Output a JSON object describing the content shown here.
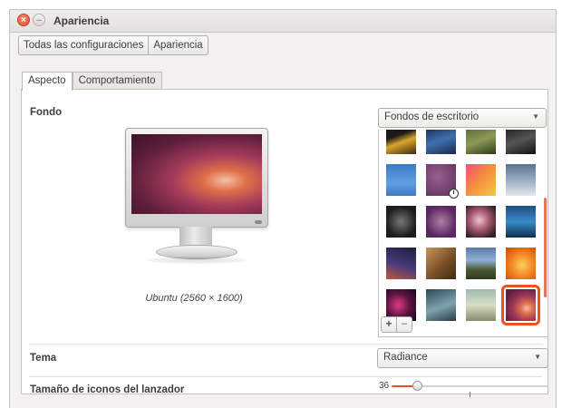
{
  "window": {
    "title": "Apariencia",
    "close_glyph": "×",
    "minimize_glyph": "–"
  },
  "breadcrumb": [
    "Todas las configuraciones",
    "Apariencia"
  ],
  "tabs": [
    {
      "label": "Aspecto",
      "active": true
    },
    {
      "label": "Comportamiento",
      "active": false
    }
  ],
  "background": {
    "label": "Fondo",
    "source_value": "Fondos de escritorio",
    "caption": "Ubuntu (2560 × 1600)",
    "add_label": "+",
    "remove_label": "−",
    "thumbnails": [
      {
        "name": "wallpaper-1",
        "bg": "linear-gradient(160deg,#1a1a1a 40%,#d9a52e 60%,#3b2a10)"
      },
      {
        "name": "wallpaper-2",
        "bg": "linear-gradient(160deg,#0d1d3c,#3f6fb0 55%,#1a2a4a)"
      },
      {
        "name": "wallpaper-3",
        "bg": "linear-gradient(160deg,#4c5a30,#8c9a58 55%,#2f3a1c)"
      },
      {
        "name": "wallpaper-4",
        "bg": "linear-gradient(160deg,#111,#555 55%,#111)"
      },
      {
        "name": "wallpaper-5",
        "bg": "linear-gradient(180deg,#3d7ac5,#5fa0e0 60%,#3d7ac5)"
      },
      {
        "name": "wallpaper-6",
        "bg": "radial-gradient(circle at 40% 40%,#9a5f8e,#5a2f5a)",
        "clock": true
      },
      {
        "name": "wallpaper-7",
        "bg": "linear-gradient(135deg,#f24e78,#f5913c 50%,#f7c84a)"
      },
      {
        "name": "wallpaper-8",
        "bg": "linear-gradient(180deg,#5d7290,#9fb2c6 55%,#e2e8ee)"
      },
      {
        "name": "wallpaper-9",
        "bg": "radial-gradient(circle at 50% 50%,#777,#1c1c1c 70%)"
      },
      {
        "name": "wallpaper-10",
        "bg": "radial-gradient(circle at 50% 50%,#b07fa8,#5a2760 70%)"
      },
      {
        "name": "wallpaper-11",
        "bg": "radial-gradient(circle at 45% 45%,#f0c5c9,#a85a72 40%,#3a1f28 80%)"
      },
      {
        "name": "wallpaper-12",
        "bg": "linear-gradient(180deg,#1f4d80,#3a8cc8 50%,#0e2e52)"
      },
      {
        "name": "wallpaper-13",
        "bg": "linear-gradient(200deg,#1a1f3c,#4a3a7a 55%,#c0583a)"
      },
      {
        "name": "wallpaper-14",
        "bg": "linear-gradient(135deg,#c8955c,#7a5028 55%,#3e2810)"
      },
      {
        "name": "wallpaper-15",
        "bg": "linear-gradient(180deg,#5c7aa8,#8fb0d8 40%,#4a5a32 70%,#2f3a1c)"
      },
      {
        "name": "wallpaper-16",
        "bg": "radial-gradient(circle at 55% 55%,#fbd15a,#f0831e 50%,#c44a10)"
      },
      {
        "name": "wallpaper-17",
        "bg": "radial-gradient(circle at 40% 50%,#e23a82,#5a1440 50%,#140816)"
      },
      {
        "name": "wallpaper-18",
        "bg": "linear-gradient(160deg,#2c4a56,#7fa3ae 55%,#253c44)"
      },
      {
        "name": "wallpaper-19",
        "bg": "linear-gradient(180deg,#9fb8b0,#d8dfc6 50%,#8a8a6a)"
      },
      {
        "name": "wallpaper-20",
        "bg": "radial-gradient(ellipse at 70% 60%,#f3c0a6,#e0704a 20%,#a33a5a 45%,#5e1e3c 80%)",
        "selected": true
      }
    ]
  },
  "theme": {
    "label": "Tema",
    "value": "Radiance"
  },
  "launcher": {
    "label": "Tamaño de iconos del lanzador",
    "value_label": "36",
    "value": 36,
    "fraction": 0.16
  },
  "colors": {
    "accent": "#e8531f",
    "close": "#df4a2a"
  },
  "icons": {
    "close": "close-icon",
    "minimize": "minimize-icon",
    "dropdown": "chevron-down-icon",
    "clock": "clock-icon"
  }
}
